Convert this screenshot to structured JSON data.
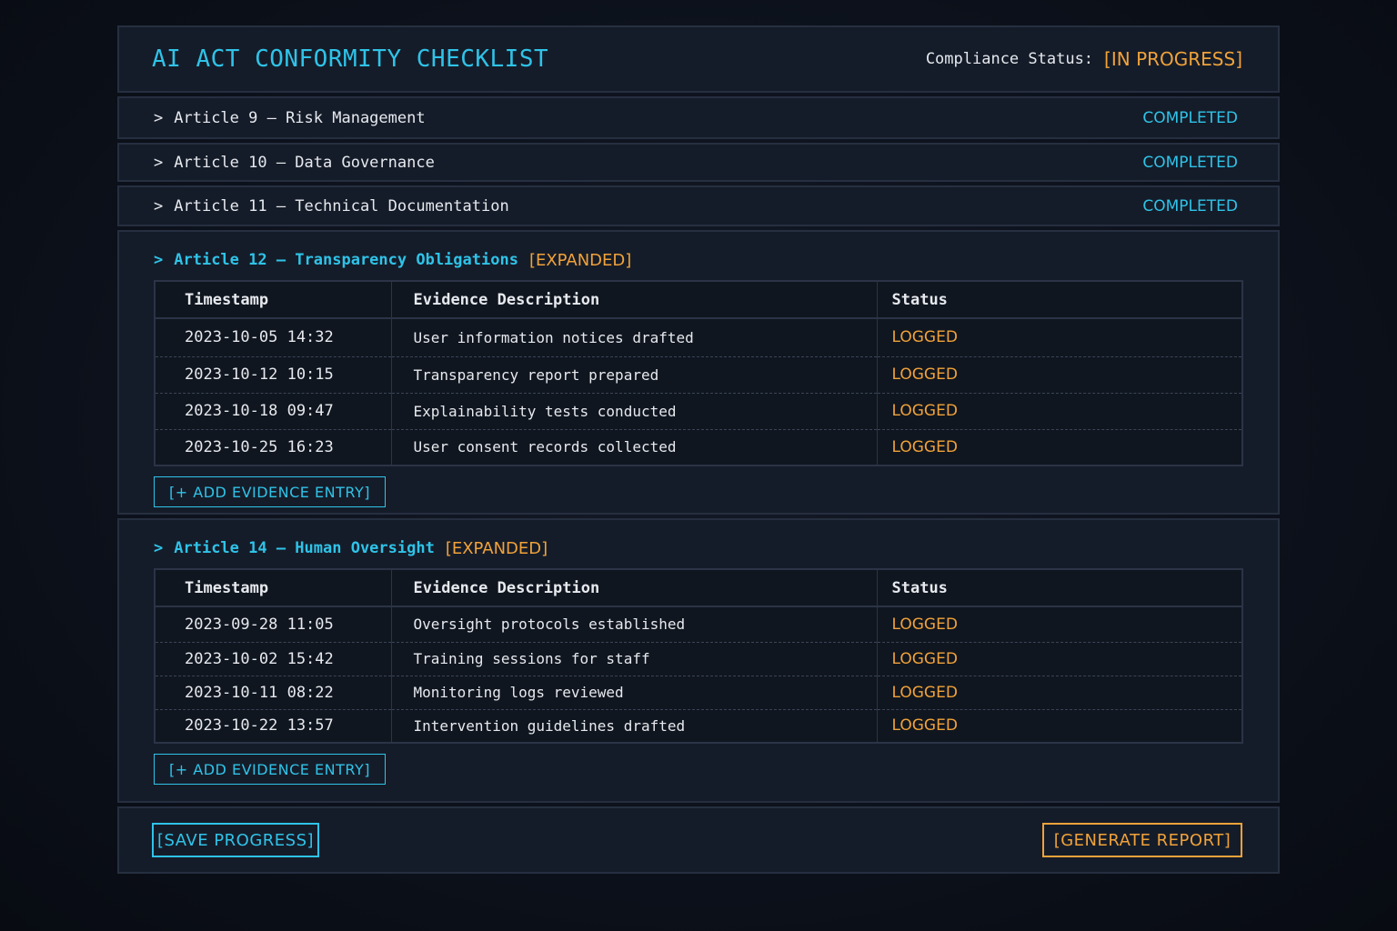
{
  "header": {
    "title": "AI ACT CONFORMITY CHECKLIST",
    "status_label": "Compliance Status:",
    "status_value": "[IN PROGRESS]"
  },
  "collapsed_articles": [
    {
      "label": "Article 9 – Risk Management",
      "status": "COMPLETED"
    },
    {
      "label": "Article 10 – Data Governance",
      "status": "COMPLETED"
    },
    {
      "label": "Article 11 – Technical Documentation",
      "status": "COMPLETED"
    }
  ],
  "columns": {
    "timestamp": "Timestamp",
    "description": "Evidence Description",
    "status": "Status"
  },
  "chevron": ">",
  "article12": {
    "title": "Article 12 – Transparency Obligations",
    "tag": "[EXPANDED]",
    "rows": [
      {
        "timestamp": "2023-10-05 14:32",
        "description": "User information notices drafted",
        "status": "LOGGED"
      },
      {
        "timestamp": "2023-10-12 10:15",
        "description": "Transparency report prepared",
        "status": "LOGGED"
      },
      {
        "timestamp": "2023-10-18 09:47",
        "description": "Explainability tests conducted",
        "status": "LOGGED"
      },
      {
        "timestamp": "2023-10-25 16:23",
        "description": "User consent records collected",
        "status": "LOGGED"
      }
    ],
    "add_button": "[+ ADD EVIDENCE ENTRY]"
  },
  "article14": {
    "title": "Article 14 – Human Oversight",
    "tag": "[EXPANDED]",
    "rows": [
      {
        "timestamp": "2023-09-28 11:05",
        "description": "Oversight protocols established",
        "status": "LOGGED"
      },
      {
        "timestamp": "2023-10-02 15:42",
        "description": "Training sessions for staff",
        "status": "LOGGED"
      },
      {
        "timestamp": "2023-10-11 08:22",
        "description": "Monitoring logs reviewed",
        "status": "LOGGED"
      },
      {
        "timestamp": "2023-10-22 13:57",
        "description": "Intervention guidelines drafted",
        "status": "LOGGED"
      }
    ],
    "add_button": "[+ ADD EVIDENCE ENTRY]"
  },
  "footer": {
    "save_label": "[SAVE PROGRESS]",
    "generate_label": "[GENERATE REPORT]"
  },
  "colors": {
    "accent": "#2fc3e8",
    "warning": "#f0a23a",
    "background": "#151c29"
  },
  "icons": {
    "collapse": "chevron-right-icon"
  }
}
